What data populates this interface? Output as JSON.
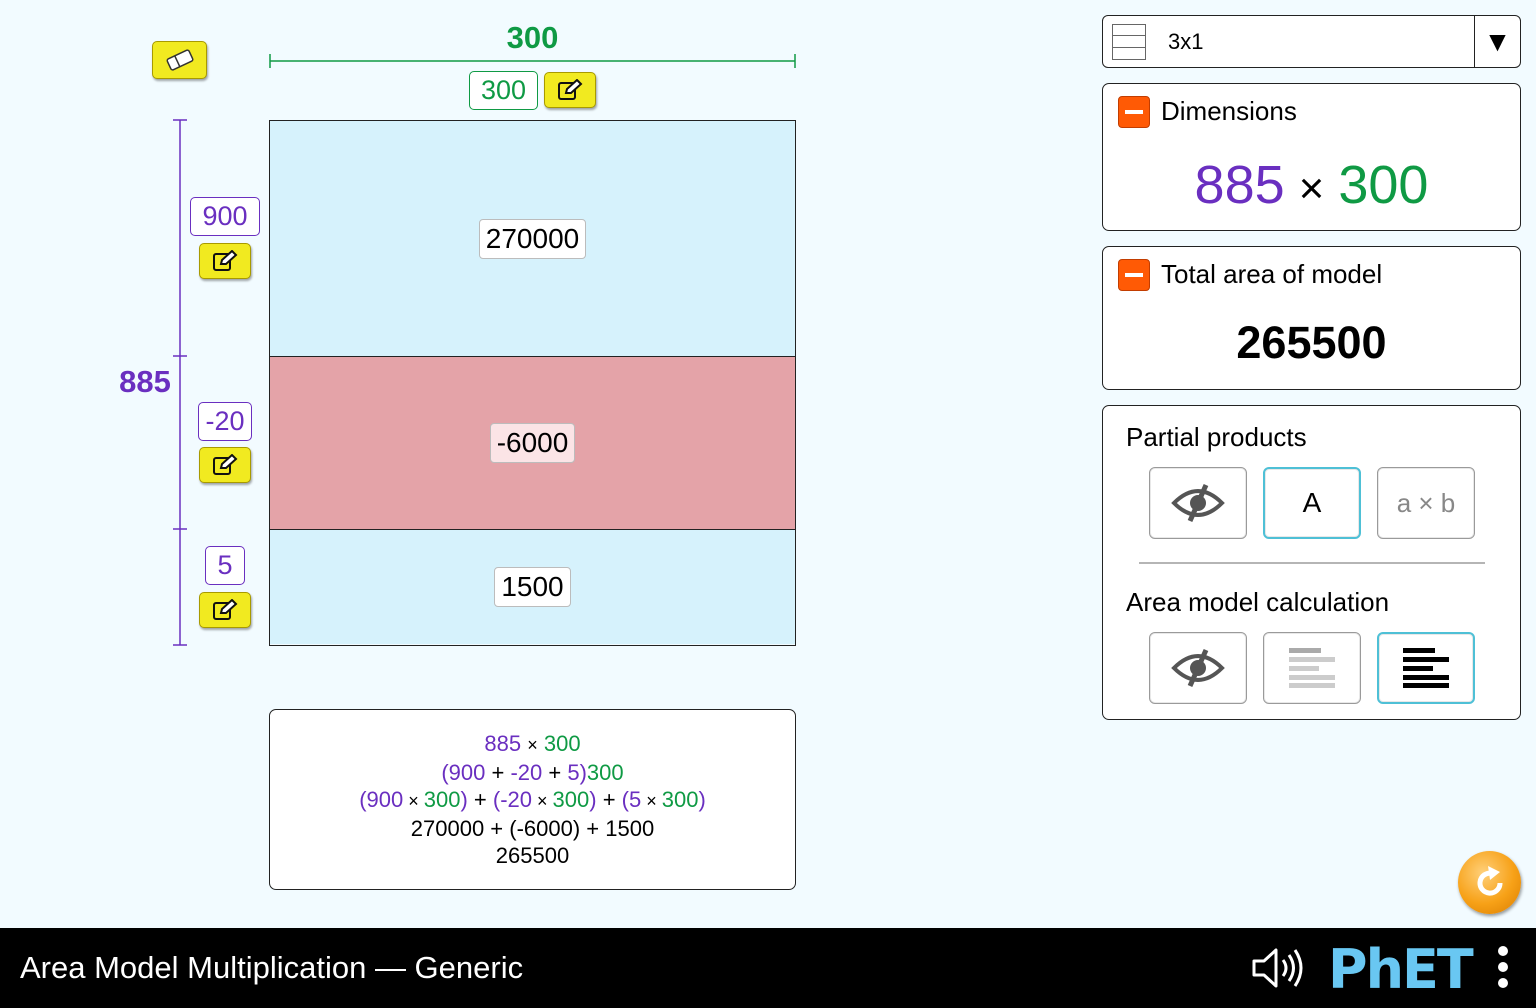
{
  "sim": {
    "title": "Area Model Multiplication — Generic"
  },
  "width_partition": {
    "total": "300",
    "values": [
      "300"
    ]
  },
  "height_partition": {
    "total": "885",
    "values": [
      "900",
      "-20",
      "5"
    ]
  },
  "partial_products": [
    "270000",
    "-6000",
    "1500"
  ],
  "calculation_lines": {
    "line1": {
      "a": "885",
      "times": "×",
      "b": "300"
    },
    "line2": {
      "open": "(",
      "v1": "900",
      "plus1": " + ",
      "v2": "-20",
      "plus2": " + ",
      "v3": "5",
      "close": ")",
      "b": "300"
    },
    "line3": {
      "t1_open": "(",
      "t1_a": "900",
      "t1_x": " × ",
      "t1_b": "300",
      "t1_close": ")",
      "plus1": " + ",
      "t2_open": "(",
      "t2_a": "-20",
      "t2_x": " × ",
      "t2_b": "300",
      "t2_close": ")",
      "plus2": " + ",
      "t3_open": "(",
      "t3_a": "5",
      "t3_x": " × ",
      "t3_b": "300",
      "t3_close": ")"
    },
    "line4": "270000 + (-6000) + 1500",
    "line5": "265500"
  },
  "layout_selector": {
    "value": "3x1"
  },
  "dimensions_panel": {
    "title": "Dimensions",
    "height_value": "885",
    "times": "×",
    "width_value": "300"
  },
  "total_area_panel": {
    "title": "Total area of model",
    "value": "265500"
  },
  "partial_products_panel": {
    "title": "Partial products",
    "options": [
      "hidden",
      "A",
      "a × b"
    ],
    "selected": "A"
  },
  "area_model_calculation_panel": {
    "title": "Area model calculation",
    "options": [
      "hidden",
      "line-by-line",
      "show-all"
    ],
    "selected": "show-all"
  },
  "colors": {
    "height": "#6a2fc0",
    "width": "#0f9a44",
    "positive_cell": "#d6f2fc",
    "negative_cell": "#e4a3a8",
    "selected_border": "#4ec0d6",
    "phet_blue": "#69c7f2"
  },
  "icons": [
    "eraser-icon",
    "pencil-icon",
    "eye-slash-icon",
    "calculation-lines-icon",
    "reset-icon",
    "sound-icon",
    "phet-logo",
    "kebab-menu-icon"
  ],
  "navbar": {
    "logo_text": "PhET"
  }
}
